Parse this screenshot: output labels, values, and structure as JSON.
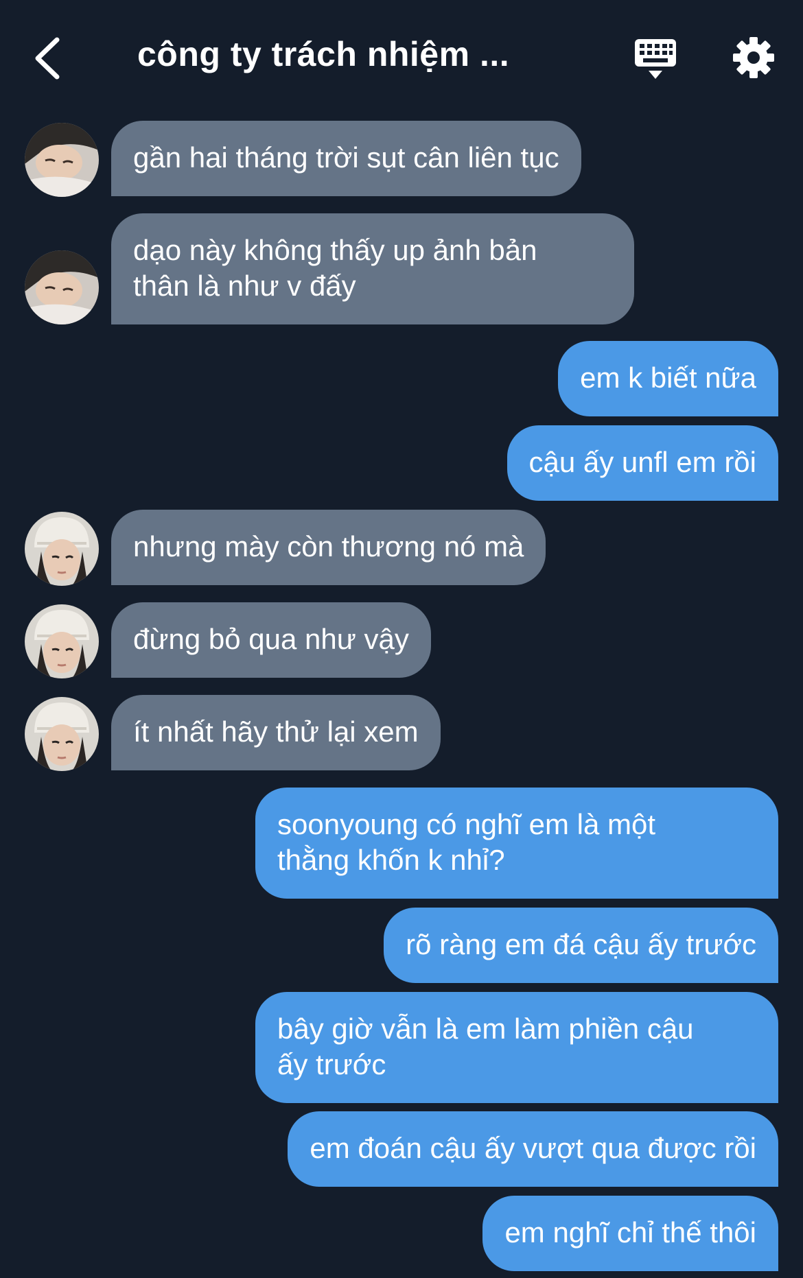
{
  "header": {
    "title": "công ty trách nhiệm ...",
    "back_icon": "chevron-left-icon",
    "keyboard_icon": "keyboard-icon",
    "settings_icon": "gear-icon"
  },
  "colors": {
    "background": "#141d2b",
    "incoming_bubble": "#657487",
    "outgoing_bubble": "#4b99e6",
    "text": "#ffffff"
  },
  "messages": [
    {
      "direction": "in",
      "avatar": "avatar-sleeping",
      "text": "gần hai tháng trời sụt cân liên tục"
    },
    {
      "direction": "in",
      "avatar": "avatar-sleeping",
      "text": "dạo này không thấy up ảnh bản\nthân là như v đấy"
    },
    {
      "direction": "out",
      "text": "em k biết nữa"
    },
    {
      "direction": "out",
      "text": "cậu ấy unfl em rồi"
    },
    {
      "direction": "in",
      "avatar": "avatar-beanie",
      "text": "nhưng mày còn thương nó mà"
    },
    {
      "direction": "in",
      "avatar": "avatar-beanie",
      "text": "đừng bỏ qua như vậy"
    },
    {
      "direction": "in",
      "avatar": "avatar-beanie",
      "text": "ít nhất hãy thử lại xem"
    },
    {
      "direction": "out",
      "text": "soonyoung có nghĩ em là một\nthằng khốn k nhỉ?"
    },
    {
      "direction": "out",
      "text": "rõ ràng em đá cậu ấy trước"
    },
    {
      "direction": "out",
      "text": "bây giờ vẫn là em làm phiền cậu\nấy trước"
    },
    {
      "direction": "out",
      "text": "em đoán cậu ấy vượt qua được rồi"
    },
    {
      "direction": "out",
      "text": "em nghĩ chỉ thế thôi"
    }
  ]
}
